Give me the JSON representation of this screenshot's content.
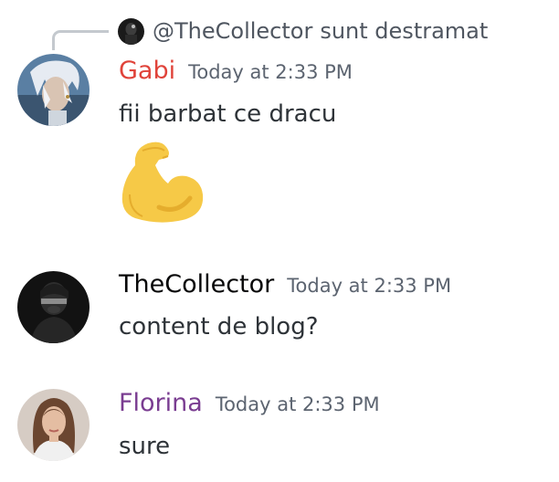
{
  "reply": {
    "user": "@TheCollector",
    "text": "sunt destramat"
  },
  "messages": [
    {
      "username": "Gabi",
      "timestamp": "Today at 2:33 PM",
      "text": "fii barbat ce dracu",
      "emoji": "flexed-biceps",
      "name_color": "#e0433a"
    },
    {
      "username": "TheCollector",
      "timestamp": "Today at 2:33 PM",
      "text": "content de blog?",
      "name_color": "#060607"
    },
    {
      "username": "Florina",
      "timestamp": "Today at 2:33 PM",
      "text": "sure",
      "name_color": "#7a3d91"
    }
  ]
}
